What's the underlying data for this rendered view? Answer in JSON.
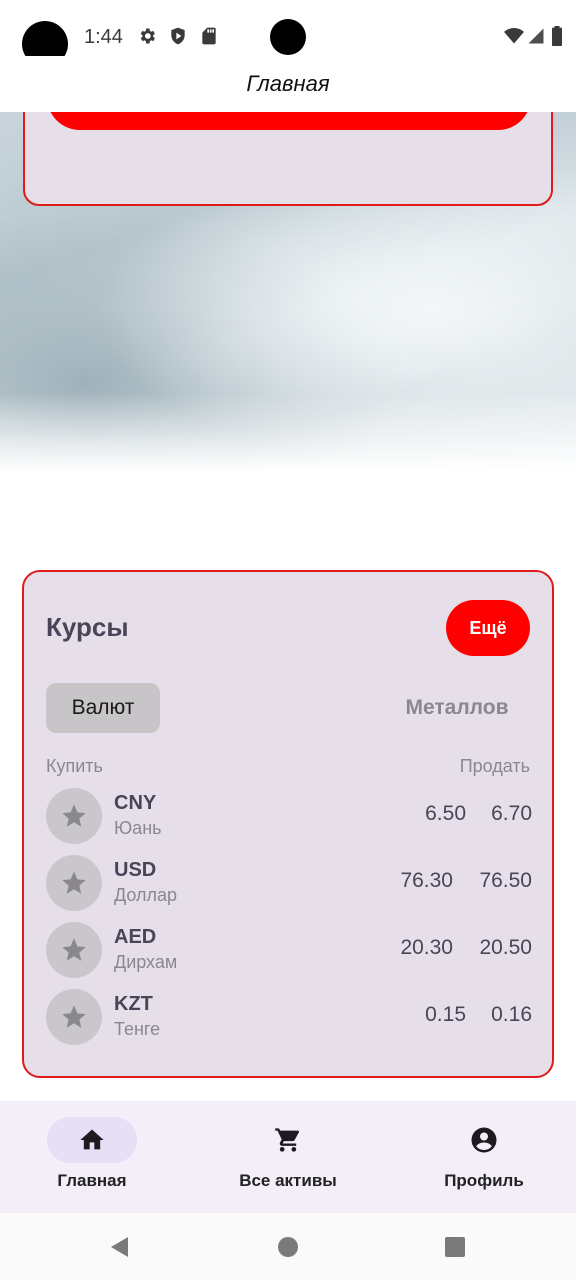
{
  "status_bar": {
    "time": "1:44",
    "icons": [
      "gear-icon",
      "shield-play-icon",
      "sd-card-icon",
      "wifi-icon",
      "signal-icon",
      "battery-icon"
    ]
  },
  "app_bar": {
    "title": "Главная"
  },
  "rates": {
    "title": "Курсы",
    "more_label": "Ещё",
    "tabs": [
      {
        "label": "Валют",
        "selected": true
      },
      {
        "label": "Металлов",
        "selected": false
      }
    ],
    "buy_header": "Купить",
    "sell_header": "Продать",
    "rows": [
      {
        "code": "CNY",
        "name": "Юань",
        "buy": "6.50",
        "sell": "6.70"
      },
      {
        "code": "USD",
        "name": "Доллар",
        "buy": "76.30",
        "sell": "76.50"
      },
      {
        "code": "AED",
        "name": "Дирхам",
        "buy": "20.30",
        "sell": "20.50"
      },
      {
        "code": "KZT",
        "name": "Тенге",
        "buy": "0.15",
        "sell": "0.16"
      }
    ]
  },
  "bottom_nav": {
    "items": [
      {
        "label": "Главная",
        "icon": "home-icon",
        "active": true
      },
      {
        "label": "Все активы",
        "icon": "cart-icon",
        "active": false
      },
      {
        "label": "Профиль",
        "icon": "account-circle-icon",
        "active": false
      }
    ]
  },
  "colors": {
    "accent": "#ff0000",
    "card_bg": "#e6dfea",
    "card_border": "#e11a1a",
    "nav_bg": "#f3eef7",
    "nav_active_pill": "#e7dff6"
  }
}
